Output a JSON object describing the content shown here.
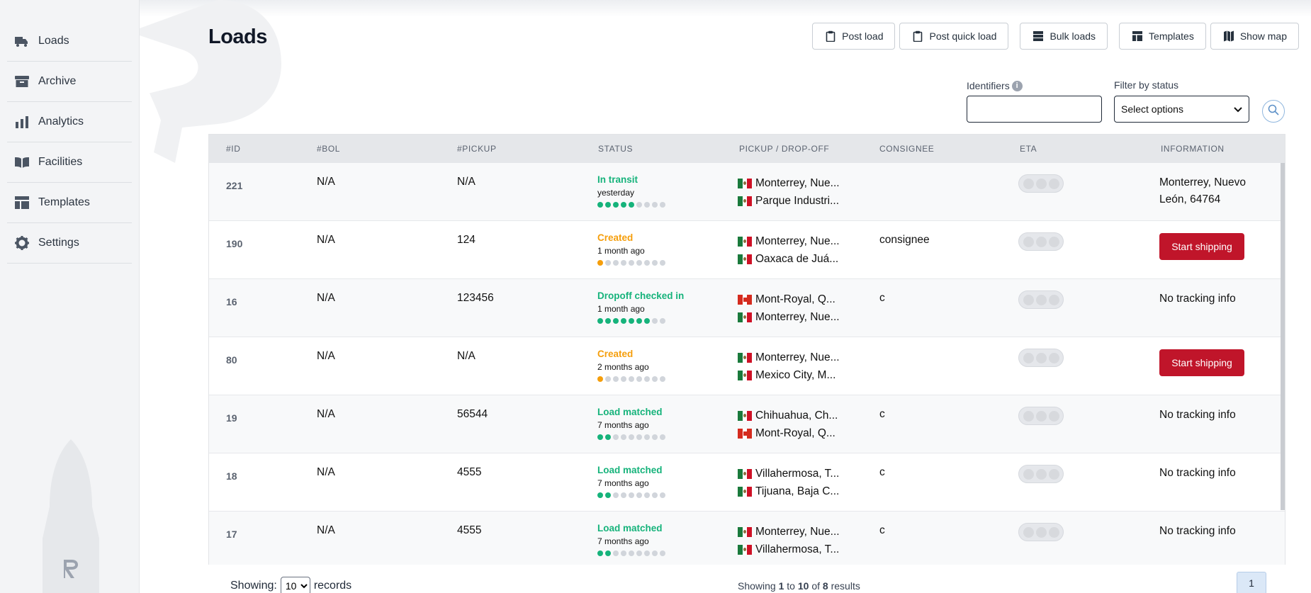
{
  "sidebar": {
    "items": [
      {
        "label": "Loads",
        "icon": "truck-icon"
      },
      {
        "label": "Archive",
        "icon": "archive-box-icon"
      },
      {
        "label": "Analytics",
        "icon": "bar-chart-icon"
      },
      {
        "label": "Facilities",
        "icon": "book-open-icon"
      },
      {
        "label": "Templates",
        "icon": "layout-icon"
      },
      {
        "label": "Settings",
        "icon": "gear-icon"
      }
    ]
  },
  "header": {
    "title": "Loads",
    "actions": {
      "post_load": "Post load",
      "post_quick_load": "Post quick load",
      "bulk_loads": "Bulk loads",
      "templates": "Templates",
      "show_map": "Show map"
    }
  },
  "filters": {
    "identifiers_label": "Identifiers",
    "identifiers_value": "",
    "status_label": "Filter by status",
    "status_value": "Select options"
  },
  "table": {
    "columns": [
      "#ID",
      "#BOL",
      "#PICKUP",
      "STATUS",
      "PICKUP / DROP-OFF",
      "CONSIGNEE",
      "ETA",
      "INFORMATION"
    ],
    "rows": [
      {
        "id": "221",
        "bol": "N/A",
        "pickup": "N/A",
        "status": "In transit",
        "status_color": "#16b37b",
        "time": "yesterday",
        "progress": 5,
        "route_from": "Monterrey, Nue...",
        "from_flag": "mx",
        "route_to": "Parque Industri...",
        "to_flag": "mx",
        "consignee": "",
        "info_type": "text",
        "info": "Monterrey, Nuevo León, 64764"
      },
      {
        "id": "190",
        "bol": "N/A",
        "pickup": "124",
        "status": "Created",
        "status_color": "#f59e0b",
        "time": "1 month ago",
        "progress": 1,
        "route_from": "Monterrey, Nue...",
        "from_flag": "mx",
        "route_to": "Oaxaca de Juá...",
        "to_flag": "mx",
        "consignee": "consignee",
        "info_type": "button",
        "info": "Start shipping"
      },
      {
        "id": "16",
        "bol": "N/A",
        "pickup": "123456",
        "status": "Dropoff checked in",
        "status_color": "#16b37b",
        "time": "1 month ago",
        "progress": 7,
        "route_from": "Mont-Royal, Q...",
        "from_flag": "ca",
        "route_to": "Monterrey, Nue...",
        "to_flag": "mx",
        "consignee": "c",
        "info_type": "text",
        "info": "No tracking info"
      },
      {
        "id": "80",
        "bol": "N/A",
        "pickup": "N/A",
        "status": "Created",
        "status_color": "#f59e0b",
        "time": "2 months ago",
        "progress": 1,
        "route_from": "Monterrey, Nue...",
        "from_flag": "mx",
        "route_to": "Mexico City, M...",
        "to_flag": "mx",
        "consignee": "",
        "info_type": "button",
        "info": "Start shipping"
      },
      {
        "id": "19",
        "bol": "N/A",
        "pickup": "56544",
        "status": "Load matched",
        "status_color": "#16b37b",
        "time": "7 months ago",
        "progress": 2,
        "route_from": "Chihuahua, Ch...",
        "from_flag": "mx",
        "route_to": "Mont-Royal, Q...",
        "to_flag": "ca",
        "consignee": "c",
        "info_type": "text",
        "info": "No tracking info"
      },
      {
        "id": "18",
        "bol": "N/A",
        "pickup": "4555",
        "status": "Load matched",
        "status_color": "#16b37b",
        "time": "7 months ago",
        "progress": 2,
        "route_from": "Villahermosa, T...",
        "from_flag": "mx",
        "route_to": "Tijuana, Baja C...",
        "to_flag": "mx",
        "consignee": "c",
        "info_type": "text",
        "info": "No tracking info"
      },
      {
        "id": "17",
        "bol": "N/A",
        "pickup": "4555",
        "status": "Load matched",
        "status_color": "#16b37b",
        "time": "7 months ago",
        "progress": 2,
        "route_from": "Monterrey, Nue...",
        "from_flag": "mx",
        "route_to": "Villahermosa, T...",
        "to_flag": "mx",
        "consignee": "c",
        "info_type": "text",
        "info": "No tracking info"
      }
    ]
  },
  "footer": {
    "showing_label": "Showing:",
    "per_page": "10",
    "records_label": "records",
    "results_prefix": "Showing",
    "results_from": "1",
    "results_to_word": "to",
    "results_to": "10",
    "results_of_word": "of",
    "results_total": "8",
    "results_suffix": "results",
    "current_page": "1"
  },
  "colors": {
    "accent_red": "#c0152a",
    "success_green": "#16b37b",
    "warning_orange": "#f59e0b"
  }
}
